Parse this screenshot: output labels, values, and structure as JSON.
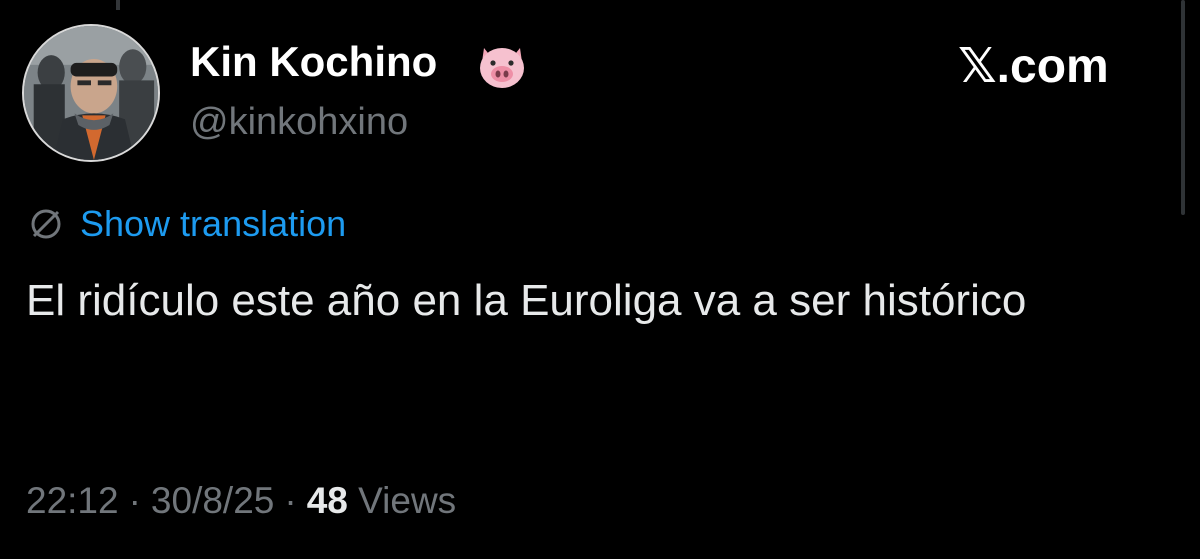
{
  "author": {
    "display_name": "Kin Kochino",
    "name_emoji": "pig-face-emoji",
    "handle": "@kinkohxino",
    "avatar_icon": "profile-photo"
  },
  "brand": {
    "label": "𝕏.com"
  },
  "translation": {
    "icon": "globe-icon",
    "label": "Show translation"
  },
  "tweet": {
    "text": "El ridículo este año en la Euroliga va a ser histórico"
  },
  "meta": {
    "time": "22:12",
    "separator": "·",
    "date": "30/8/25",
    "views_count": "48",
    "views_label": "Views"
  },
  "colors": {
    "background": "#000000",
    "text_primary": "#e7e9ea",
    "text_secondary": "#71767b",
    "link": "#1d9bf0"
  }
}
